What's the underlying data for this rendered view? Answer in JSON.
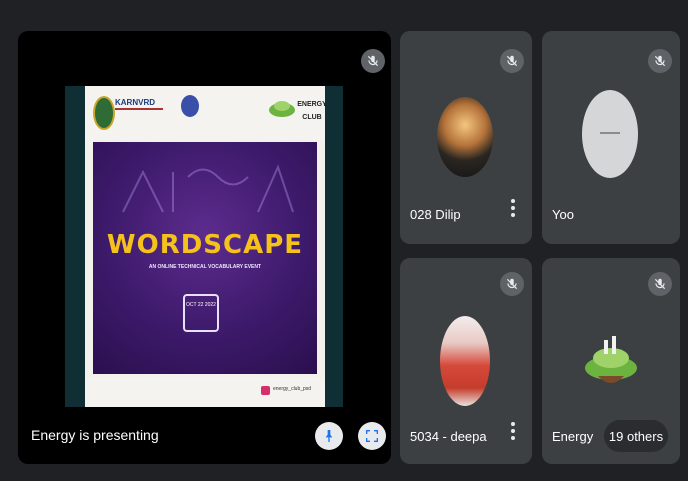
{
  "main_stage": {
    "presenting_label": "Energy is presenting",
    "slide": {
      "header_left_text": "KARNVRD",
      "header_right_title": "ENERGY\nCLUB",
      "poster_title": "WORDSCAPE",
      "poster_subtitle": "AN ONLINE TECHNICAL VOCABULARY EVENT",
      "poster_box_text": "OCT 22 2022",
      "footer_handle": "energy_club_psd"
    },
    "pin_button_icon": "pin-icon",
    "fullscreen_button_icon": "fullscreen-icon"
  },
  "participants": [
    {
      "name": "028 Dilip",
      "muted": true
    },
    {
      "name": "Yoo",
      "muted": true
    },
    {
      "name": "5034 - deepa",
      "muted": true
    },
    {
      "name": "Energy",
      "muted": true
    }
  ],
  "others_label": "19 others",
  "colors": {
    "background": "#202124",
    "tile": "#3c4043",
    "poster_purple": "#3d1a6b",
    "poster_title_yellow": "#f5c21b"
  }
}
